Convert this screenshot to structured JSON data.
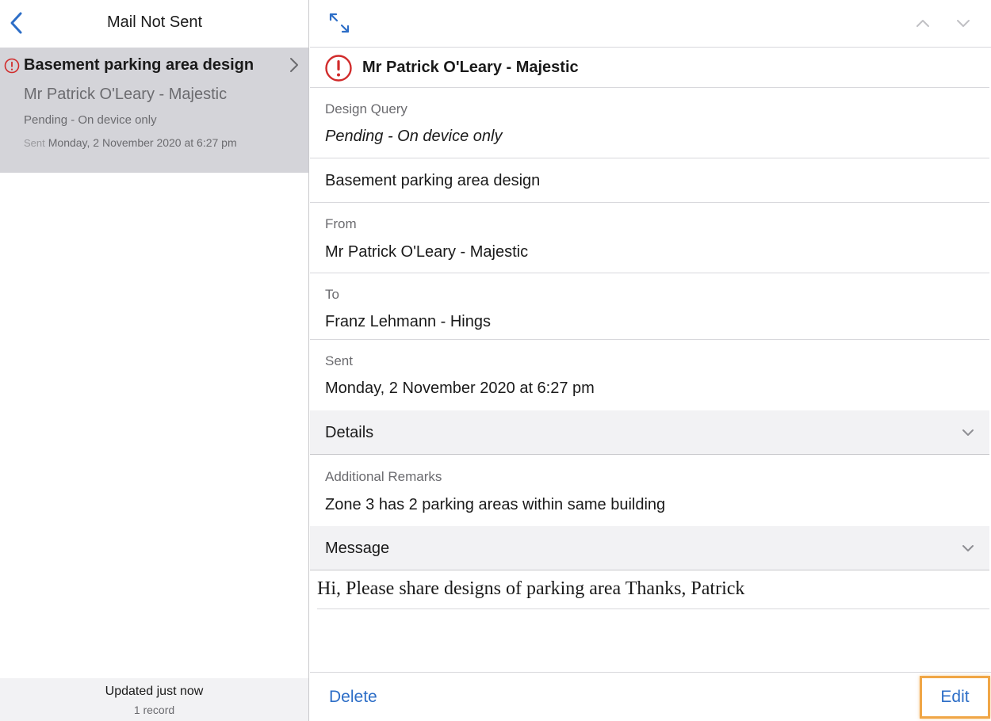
{
  "sidebar": {
    "title": "Mail Not Sent",
    "item": {
      "subject": "Basement parking area design",
      "sender": "Mr Patrick O'Leary - Majestic",
      "status": "Pending - On device only",
      "sent_label": "Sent",
      "sent_date": "Monday, 2 November 2020 at 6:27 pm"
    },
    "footer": {
      "updated": "Updated just now",
      "records": "1 record"
    }
  },
  "detail": {
    "header_name": "Mr Patrick O'Leary - Majestic",
    "type_label": "Design Query",
    "type_status": "Pending - On device only",
    "subject": "Basement parking area design",
    "from_label": "From",
    "from_value": "Mr Patrick O'Leary - Majestic",
    "to_label": "To",
    "to_value": "Franz Lehmann - Hings",
    "sent_label": "Sent",
    "sent_value": "Monday, 2 November 2020 at 6:27 pm",
    "details_section": "Details",
    "remarks_label": "Additional Remarks",
    "remarks_value": "Zone 3 has 2 parking areas within same building",
    "message_section": "Message",
    "message_body": "Hi, Please share designs of parking area Thanks, Patrick"
  },
  "actions": {
    "delete_label": "Delete",
    "edit_label": "Edit"
  },
  "colors": {
    "accent": "#2d6ec7",
    "error": "#d12b2b",
    "selected_row": "#d4d4d9",
    "highlight": "#f0a646"
  },
  "icons": {
    "back": "chevron-left-icon",
    "expand": "expand-icon",
    "error": "alert-circle-icon",
    "up": "chevron-up-icon",
    "down": "chevron-down-icon"
  }
}
